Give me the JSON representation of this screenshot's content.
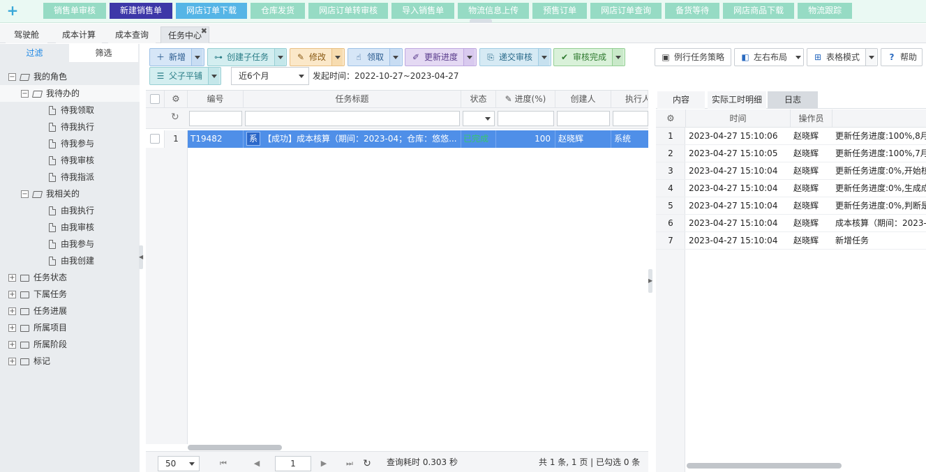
{
  "quick_bar": {
    "add_icon": "plus-icon",
    "buttons": [
      "销售单审核",
      "新建销售单",
      "网店订单下载",
      "仓库发货",
      "网店订单转审核",
      "导入销售单",
      "物流信息上传",
      "预售订单",
      "网店订单查询",
      "备货等待",
      "网店商品下载",
      "物流跟踪"
    ],
    "active_index": 1,
    "colors": {
      "normal": "#96dbc4",
      "active": "#3d38a8",
      "highlight": "#55b5e6"
    }
  },
  "page_tabs": [
    "驾驶舱",
    "成本计算",
    "成本查询",
    "任务中心"
  ],
  "active_page_tab": "任务中心",
  "left_panel": {
    "tabs": [
      "过滤",
      "筛选"
    ],
    "tree": {
      "my_roles": "我的角色",
      "my_todo": "我待办的",
      "todo_items": [
        "待我领取",
        "待我执行",
        "待我参与",
        "待我审核",
        "待我指派"
      ],
      "my_related": "我相关的",
      "related_items": [
        "由我执行",
        "由我审核",
        "由我参与",
        "由我创建"
      ],
      "groups": [
        "任务状态",
        "下属任务",
        "任务进展",
        "所属项目",
        "所属阶段",
        "标记"
      ]
    }
  },
  "toolbar": {
    "new": "新增",
    "create_subtask": "创建子任务",
    "edit": "修改",
    "claim": "领取",
    "update_progress": "更新进度",
    "submit_review": "递交审核",
    "review_done": "审核完成",
    "routine_strategy": "例行任务策略",
    "layout": "左右布局",
    "table_mode": "表格模式",
    "help": "帮助",
    "balance": "父子平铺",
    "range": "近6个月",
    "range_label": "发起时间：2022-10-27~2023-04-27"
  },
  "grid": {
    "columns": [
      "编号",
      "任务标题",
      "状态",
      "进度(%)",
      "创建人",
      "执行人"
    ],
    "rows": [
      {
        "num": "1",
        "id": "T19482",
        "tag": "系",
        "title": "【成功】成本核算（期间：2023-04；仓库：悠悠...",
        "status": "已完成",
        "progress": "100",
        "creator": "赵晓辉",
        "executor": "系统"
      }
    ],
    "status_color": "#37c86a",
    "selected_color": "#4f8fe8"
  },
  "pager": {
    "page_size": "50",
    "page": "1",
    "query_time": "查询耗时 0.303 秒",
    "summary": "共 1 条, 1 页 | 已勾选 0 条"
  },
  "right_panel": {
    "tabs": [
      "内容",
      "实际工时明细",
      "日志"
    ],
    "active_tab": "日志",
    "columns": [
      "时间",
      "操作员"
    ],
    "logs": [
      {
        "num": "1",
        "time": "2023-04-27 15:10:06",
        "op": "赵晓辉",
        "desc": "更新任务进度:100%,8月"
      },
      {
        "num": "2",
        "time": "2023-04-27 15:10:05",
        "op": "赵晓辉",
        "desc": "更新任务进度:100%,7月"
      },
      {
        "num": "3",
        "time": "2023-04-27 15:10:04",
        "op": "赵晓辉",
        "desc": "更新任务进度:0%,开始核"
      },
      {
        "num": "4",
        "time": "2023-04-27 15:10:04",
        "op": "赵晓辉",
        "desc": "更新任务进度:0%,生成成"
      },
      {
        "num": "5",
        "time": "2023-04-27 15:10:04",
        "op": "赵晓辉",
        "desc": "更新任务进度:0%,判断是"
      },
      {
        "num": "6",
        "time": "2023-04-27 15:10:04",
        "op": "赵晓辉",
        "desc": "成本核算（期间：2023-"
      },
      {
        "num": "7",
        "time": "2023-04-27 15:10:04",
        "op": "赵晓辉",
        "desc": "新增任务"
      }
    ]
  }
}
